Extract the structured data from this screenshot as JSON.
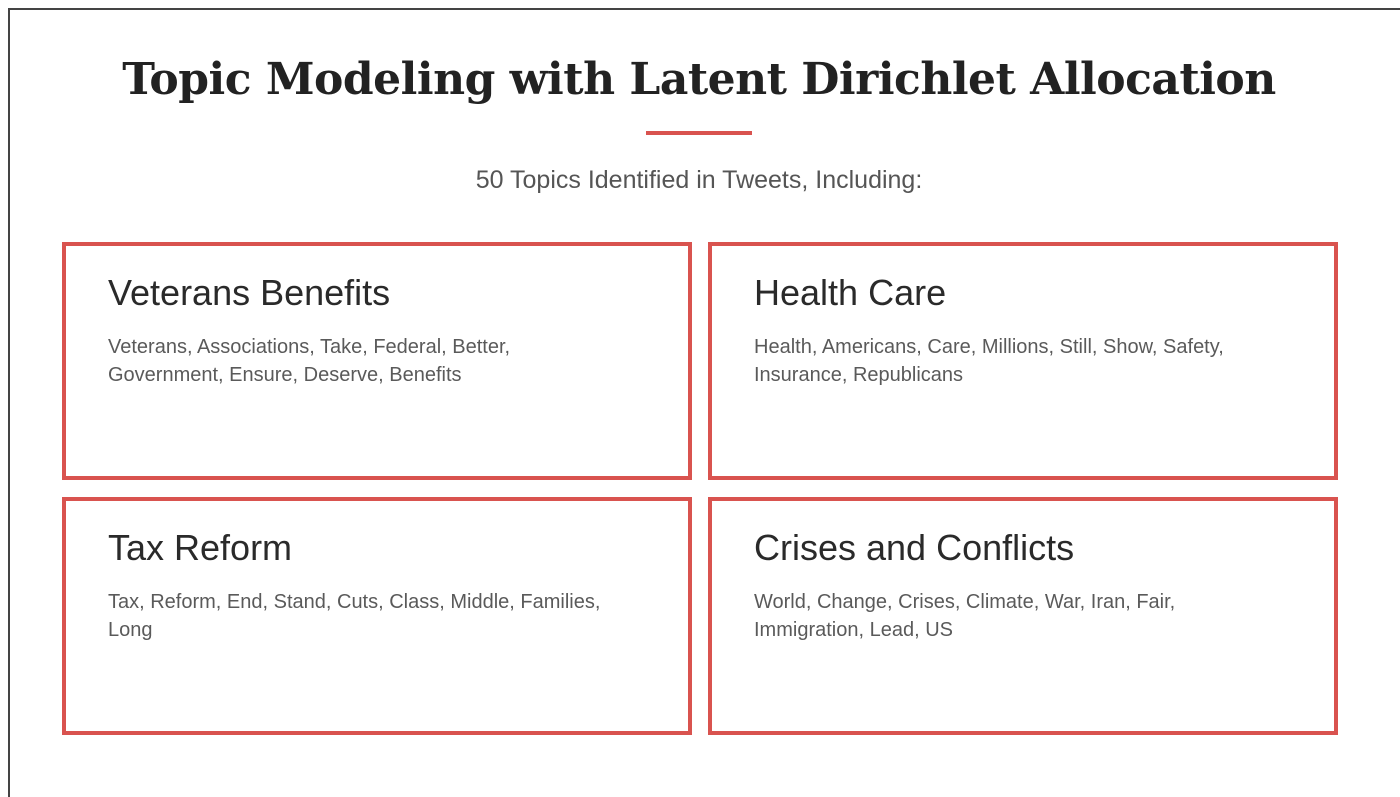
{
  "title": "Topic Modeling with Latent Dirichlet Allocation",
  "subtitle": "50 Topics Identified in Tweets, Including:",
  "accent_color": "#d9534f",
  "topics": [
    {
      "title": "Veterans Benefits",
      "words": "Veterans, Associations, Take, Federal, Better, Government, Ensure, Deserve, Benefits"
    },
    {
      "title": "Health Care",
      "words": "Health, Americans, Care, Millions, Still, Show, Safety, Insurance, Republicans"
    },
    {
      "title": "Tax Reform",
      "words": "Tax, Reform, End, Stand, Cuts, Class, Middle, Families, Long"
    },
    {
      "title": "Crises and Conflicts",
      "words": "World, Change, Crises, Climate, War, Iran, Fair, Immigration, Lead, US"
    }
  ]
}
